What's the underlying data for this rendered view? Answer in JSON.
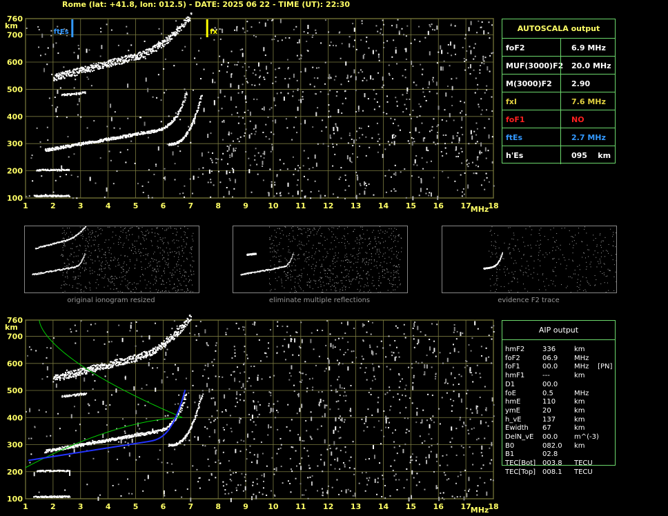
{
  "header": {
    "title": "Rome (lat: +41.8, lon: 012.5) - DATE: 2025 06 22 - TIME (UT): 22:30"
  },
  "colors": {
    "grid": "#ffff66",
    "frame": "#ffff66",
    "table_border": "#6cd96c",
    "fxI": "#e0d040",
    "foF1": "#ff2020",
    "ftEs": "#3399ff",
    "trace": "#ffffff",
    "profile_green": "#00d000",
    "profile_blue": "#2233ff"
  },
  "axes": {
    "y_label": "km",
    "y_ticks": [
      "100",
      "200",
      "300",
      "400",
      "500",
      "600",
      "700",
      "760"
    ],
    "x_label": "MHz",
    "x_ticks": [
      "1",
      "2",
      "3",
      "4",
      "5",
      "6",
      "7",
      "8",
      "9",
      "10",
      "11",
      "12",
      "13",
      "14",
      "15",
      "16",
      "17",
      "18"
    ],
    "x_range": [
      1,
      18
    ],
    "y_range": [
      100,
      760
    ]
  },
  "top_plot": {
    "markers": [
      {
        "label": "ftEs",
        "freq": 2.7,
        "color": "#3399ff"
      },
      {
        "label": "fx",
        "freq": 7.6,
        "color": "#ffff00"
      }
    ]
  },
  "autoscala": {
    "title": "AUTOSCALA output",
    "rows": [
      {
        "name": "foF2",
        "value": "6.9 MHz",
        "color": "#ffffff"
      },
      {
        "name": "MUF(3000)F2",
        "value": "20.0 MHz",
        "color": "#ffffff"
      },
      {
        "name": "M(3000)F2",
        "value": "2.90",
        "color": "#ffffff"
      },
      {
        "name": "fxI",
        "value": "7.6 MHz",
        "color": "#e0d040"
      },
      {
        "name": "foF1",
        "value": "NO",
        "color": "#ff2020"
      },
      {
        "name": "ftEs",
        "value": "2.7 MHz",
        "color": "#3399ff"
      },
      {
        "name": "h'Es",
        "value": "095    km",
        "color": "#ffffff"
      }
    ]
  },
  "thumbnails": [
    {
      "caption": "original ionogram resized"
    },
    {
      "caption": "eliminate multiple reflections"
    },
    {
      "caption": "evidence F2 trace"
    }
  ],
  "aip": {
    "title": "AIP output",
    "rows": [
      {
        "name": "hmF2",
        "value": "336",
        "unit": "km"
      },
      {
        "name": "foF2",
        "value": "06.9",
        "unit": "MHz"
      },
      {
        "name": "foF1",
        "value": "00.0",
        "unit": "MHz    [PN]"
      },
      {
        "name": "hmF1",
        "value": "---",
        "unit": "km"
      },
      {
        "name": "D1",
        "value": "00.0",
        "unit": ""
      },
      {
        "name": "foE",
        "value": "0.5",
        "unit": "MHz"
      },
      {
        "name": "hmE",
        "value": "110",
        "unit": "km"
      },
      {
        "name": "ymE",
        "value": "20",
        "unit": "km"
      },
      {
        "name": "h_vE",
        "value": "137",
        "unit": "km"
      },
      {
        "name": "Ewidth",
        "value": "67",
        "unit": "km"
      },
      {
        "name": "DelN_vE",
        "value": "00.0",
        "unit": "m^(-3)"
      },
      {
        "name": "B0",
        "value": "082.0",
        "unit": "km"
      },
      {
        "name": "B1",
        "value": "02.8",
        "unit": ""
      },
      {
        "name": "TEC[Bot]",
        "value": "003.8",
        "unit": "TECU"
      },
      {
        "name": "TEC[Top]",
        "value": "008.1",
        "unit": "TECU"
      }
    ]
  }
}
